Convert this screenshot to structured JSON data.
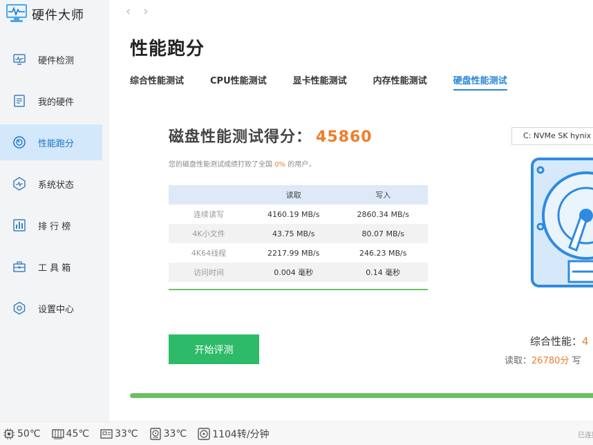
{
  "app": {
    "title": "硬件大师"
  },
  "sidebar": {
    "items": [
      {
        "label": "硬件检测",
        "icon": "monitor-icon"
      },
      {
        "label": "我的硬件",
        "icon": "hardware-list-icon"
      },
      {
        "label": "性能跑分",
        "icon": "speedometer-icon",
        "active": true
      },
      {
        "label": "系统状态",
        "icon": "system-status-icon"
      },
      {
        "label": "排 行 榜",
        "icon": "ranking-icon"
      },
      {
        "label": "工 具 箱",
        "icon": "toolbox-icon"
      },
      {
        "label": "设置中心",
        "icon": "settings-icon"
      }
    ]
  },
  "nav": {
    "back": "‹",
    "forward": "›"
  },
  "page": {
    "title": "性能跑分",
    "tabs": [
      "综合性能测试",
      "CPU性能测试",
      "显卡性能测试",
      "内存性能测试",
      "硬盘性能测试"
    ],
    "active_tab": 4
  },
  "score": {
    "label": "磁盘性能测试得分：",
    "value": "45860",
    "sub_prefix": "您的磁盘性能测试成绩打败了全国",
    "sub_pct": "0%",
    "sub_suffix": "的用户，"
  },
  "table": {
    "headers": [
      "",
      "读取",
      "写入"
    ],
    "rows": [
      [
        "连续读写",
        "4160.19 MB/s",
        "2860.34 MB/s"
      ],
      [
        "4K小文件",
        "43.75 MB/s",
        "80.07 MB/s"
      ],
      [
        "4K64线程",
        "2217.99 MB/s",
        "246.23 MB/s"
      ],
      [
        "访问时间",
        "0.004 毫秒",
        "0.14 毫秒"
      ]
    ]
  },
  "actions": {
    "start_label": "开始评测"
  },
  "disk": {
    "selected": "C: NVMe SK hynix B"
  },
  "summary": {
    "label": "综合性能：",
    "value": "4",
    "read_label": "读取：",
    "read_value": "26780分",
    "write_label": "写"
  },
  "progress": {
    "value": 1.0
  },
  "statusbar": {
    "items": [
      {
        "icon": "cpu-chip-icon",
        "value": "50℃"
      },
      {
        "icon": "gpu-card-icon",
        "value": "45℃"
      },
      {
        "icon": "motherboard-icon",
        "value": "33℃"
      },
      {
        "icon": "disk-drive-icon",
        "value": "33℃"
      },
      {
        "icon": "fan-icon",
        "value": "1104转/分钟"
      }
    ],
    "right_text": "已连接"
  },
  "colors": {
    "accent_blue": "#2a86d6",
    "score_orange": "#f07c2c",
    "green": "#2dbb6a",
    "progress_green": "#6ac15f",
    "sidebar_active": "#d3e8fb"
  }
}
